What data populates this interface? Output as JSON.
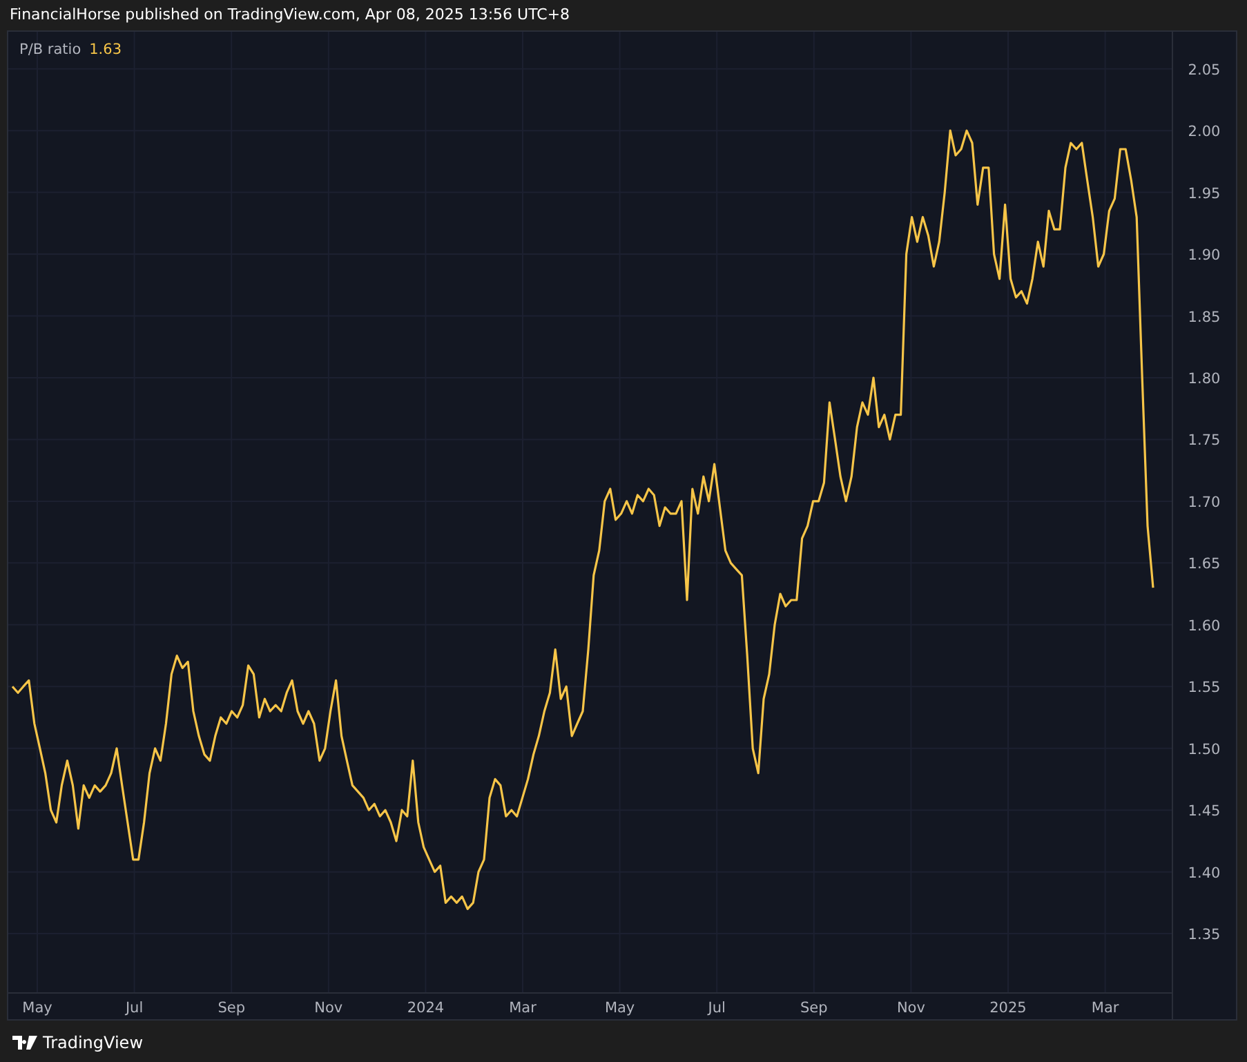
{
  "header": {
    "caption": "FinancialHorse published on TradingView.com, Apr 08, 2025 13:56 UTC+8"
  },
  "chart": {
    "legend": {
      "value": "1.63"
    },
    "x_axis_labels": [
      "May",
      "Jul",
      "Sep",
      "Nov",
      "2024",
      "Mar",
      "May",
      "Jul",
      "Sep",
      "Nov",
      "2025",
      "Mar"
    ],
    "chart_data": {
      "type": "line",
      "grid": true,
      "ylim": [
        1.302,
        2.08
      ],
      "yticks": [
        {
          "value": 1.35,
          "label": "1.35"
        },
        {
          "value": 1.4,
          "label": "1.40"
        },
        {
          "value": 1.45,
          "label": "1.45"
        },
        {
          "value": 1.5,
          "label": "1.50"
        },
        {
          "value": 1.55,
          "label": "1.55"
        },
        {
          "value": 1.6,
          "label": "1.60"
        },
        {
          "value": 1.65,
          "label": "1.65"
        },
        {
          "value": 1.7,
          "label": "1.70"
        },
        {
          "value": 1.75,
          "label": "1.75"
        },
        {
          "value": 1.8,
          "label": "1.80"
        },
        {
          "value": 1.85,
          "label": "1.85"
        },
        {
          "value": 1.9,
          "label": "1.90"
        },
        {
          "value": 1.95,
          "label": "1.95"
        },
        {
          "value": 2.0,
          "label": "2.00"
        },
        {
          "value": 2.05,
          "label": "2.05"
        }
      ],
      "series": [
        {
          "name": "P/B ratio",
          "color": "#f7c548",
          "values": [
            1.55,
            1.545,
            1.55,
            1.555,
            1.52,
            1.5,
            1.48,
            1.45,
            1.44,
            1.47,
            1.49,
            1.47,
            1.435,
            1.47,
            1.46,
            1.47,
            1.465,
            1.47,
            1.48,
            1.5,
            1.47,
            1.44,
            1.41,
            1.41,
            1.44,
            1.48,
            1.5,
            1.49,
            1.52,
            1.56,
            1.575,
            1.565,
            1.57,
            1.53,
            1.51,
            1.495,
            1.49,
            1.51,
            1.525,
            1.52,
            1.53,
            1.525,
            1.535,
            1.567,
            1.56,
            1.525,
            1.54,
            1.53,
            1.535,
            1.53,
            1.545,
            1.555,
            1.53,
            1.52,
            1.53,
            1.52,
            1.49,
            1.5,
            1.53,
            1.555,
            1.51,
            1.49,
            1.47,
            1.465,
            1.46,
            1.45,
            1.455,
            1.445,
            1.45,
            1.44,
            1.425,
            1.45,
            1.445,
            1.49,
            1.44,
            1.42,
            1.41,
            1.4,
            1.405,
            1.375,
            1.38,
            1.375,
            1.38,
            1.37,
            1.375,
            1.4,
            1.41,
            1.46,
            1.475,
            1.47,
            1.445,
            1.45,
            1.445,
            1.46,
            1.475,
            1.495,
            1.51,
            1.53,
            1.545,
            1.58,
            1.54,
            1.55,
            1.51,
            1.52,
            1.53,
            1.58,
            1.64,
            1.66,
            1.7,
            1.71,
            1.685,
            1.69,
            1.7,
            1.69,
            1.705,
            1.7,
            1.71,
            1.705,
            1.68,
            1.695,
            1.69,
            1.69,
            1.7,
            1.62,
            1.71,
            1.69,
            1.72,
            1.7,
            1.73,
            1.695,
            1.66,
            1.65,
            1.645,
            1.64,
            1.575,
            1.5,
            1.48,
            1.54,
            1.56,
            1.6,
            1.625,
            1.615,
            1.62,
            1.62,
            1.67,
            1.68,
            1.7,
            1.7,
            1.715,
            1.78,
            1.75,
            1.72,
            1.7,
            1.72,
            1.76,
            1.78,
            1.77,
            1.8,
            1.76,
            1.77,
            1.75,
            1.77,
            1.77,
            1.9,
            1.93,
            1.91,
            1.93,
            1.915,
            1.89,
            1.91,
            1.95,
            2.0,
            1.98,
            1.985,
            2.0,
            1.99,
            1.94,
            1.97,
            1.97,
            1.9,
            1.88,
            1.94,
            1.88,
            1.865,
            1.87,
            1.86,
            1.88,
            1.91,
            1.89,
            1.935,
            1.92,
            1.92,
            1.97,
            1.99,
            1.985,
            1.99,
            1.96,
            1.93,
            1.89,
            1.9,
            1.935,
            1.945,
            1.985,
            1.985,
            1.96,
            1.93,
            1.8,
            1.68,
            1.63
          ]
        }
      ]
    }
  },
  "footer": {
    "brand": "TradingView"
  }
}
